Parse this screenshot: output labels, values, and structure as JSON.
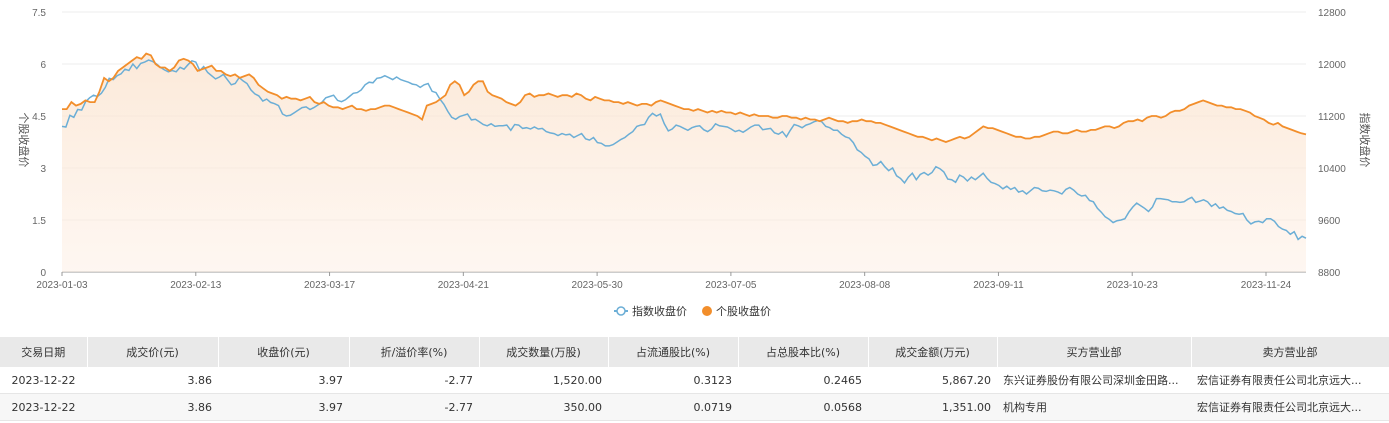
{
  "chart_data": {
    "type": "line",
    "y_left": {
      "label": "个股收盘价",
      "ticks": [
        "7.5",
        "6",
        "4.5",
        "3",
        "1.5",
        "0"
      ],
      "range": [
        0,
        7.5
      ]
    },
    "y_right": {
      "label": "指数收盘价",
      "ticks": [
        "12800",
        "12000",
        "11200",
        "10400",
        "9600",
        "8800"
      ],
      "range": [
        8800,
        12800
      ]
    },
    "x_ticks": [
      "2023-01-03",
      "2023-02-13",
      "2023-03-17",
      "2023-04-21",
      "2023-05-30",
      "2023-07-05",
      "2023-08-08",
      "2023-09-11",
      "2023-10-23",
      "2023-11-24"
    ],
    "legend": {
      "position": "bottom-center"
    },
    "series": [
      {
        "name": "指数收盘价",
        "axis": "right",
        "color": "#6baed6",
        "values": [
          11040,
          11030,
          11210,
          11180,
          11300,
          11290,
          11420,
          11480,
          11520,
          11500,
          11550,
          11640,
          11780,
          11760,
          11820,
          11850,
          11920,
          11900,
          12000,
          11930,
          12010,
          12030,
          12060,
          12040,
          12000,
          11950,
          11910,
          11880,
          11900,
          11880,
          11950,
          11920,
          11990,
          12050,
          12030,
          11900,
          11960,
          11870,
          11820,
          11770,
          11800,
          11840,
          11760,
          11680,
          11700,
          11790,
          11740,
          11700,
          11600,
          11540,
          11510,
          11430,
          11460,
          11410,
          11390,
          11360,
          11230,
          11200,
          11210,
          11250,
          11290,
          11330,
          11340,
          11300,
          11330,
          11370,
          11410,
          11480,
          11500,
          11520,
          11440,
          11420,
          11450,
          11500,
          11550,
          11560,
          11600,
          11680,
          11720,
          11710,
          11780,
          11790,
          11820,
          11790,
          11760,
          11800,
          11760,
          11740,
          11720,
          11690,
          11680,
          11640,
          11680,
          11700,
          11580,
          11560,
          11460,
          11380,
          11270,
          11180,
          11150,
          11190,
          11210,
          11230,
          11140,
          11150,
          11110,
          11070,
          11050,
          11080,
          11040,
          11050,
          11050,
          11060,
          10980,
          11070,
          11060,
          11010,
          11020,
          11000,
          11030,
          11000,
          11010,
          10960,
          10940,
          10930,
          10900,
          10930,
          10910,
          10920,
          10870,
          10900,
          10930,
          10850,
          10830,
          10870,
          10790,
          10780,
          10740,
          10740,
          10760,
          10800,
          10840,
          10870,
          10920,
          10960,
          11040,
          11060,
          11070,
          11180,
          11240,
          11200,
          11230,
          11080,
          10970,
          11000,
          11060,
          11040,
          11010,
          10980,
          11020,
          11040,
          11050,
          10990,
          10960,
          11000,
          11080,
          11050,
          11040,
          11030,
          11000,
          10960,
          10980,
          10950,
          10990,
          11030,
          11060,
          11060,
          10990,
          11000,
          11010,
          10940,
          10920,
          10960,
          10880,
          10980,
          11070,
          11050,
          11020,
          11060,
          11080,
          11110,
          11130,
          11110,
          11040,
          11020,
          10980,
          10980,
          10920,
          10880,
          10860,
          10790,
          10680,
          10640,
          10580,
          10540,
          10440,
          10450,
          10500,
          10420,
          10360,
          10400,
          10280,
          10240,
          10170,
          10260,
          10320,
          10220,
          10300,
          10330,
          10290,
          10330,
          10420,
          10390,
          10340,
          10230,
          10220,
          10180,
          10290,
          10260,
          10200,
          10260,
          10220,
          10270,
          10320,
          10240,
          10180,
          10160,
          10130,
          10080,
          10120,
          10070,
          10100,
          10030,
          10050,
          10000,
          10050,
          10100,
          10090,
          10050,
          10040,
          10060,
          10050,
          10030,
          10000,
          10070,
          10100,
          10060,
          10000,
          9970,
          9980,
          9900,
          9880,
          9780,
          9720,
          9650,
          9610,
          9560,
          9590,
          9600,
          9620,
          9720,
          9800,
          9860,
          9820,
          9780,
          9730,
          9800,
          9930,
          9930,
          9920,
          9910,
          9880,
          9880,
          9870,
          9880,
          9920,
          9950,
          9870,
          9890,
          9910,
          9880,
          9810,
          9850,
          9780,
          9800,
          9750,
          9730,
          9700,
          9690,
          9700,
          9600,
          9540,
          9570,
          9580,
          9560,
          9620,
          9620,
          9580,
          9500,
          9460,
          9440,
          9380,
          9420,
          9300,
          9350,
          9320
        ]
      },
      {
        "name": "个股收盘价",
        "axis": "left",
        "color": "#f28e2b",
        "values": [
          4.7,
          4.7,
          4.9,
          4.8,
          4.85,
          4.95,
          4.9,
          4.9,
          5.2,
          5.6,
          5.5,
          5.6,
          5.8,
          5.9,
          6.0,
          6.1,
          6.2,
          6.15,
          6.3,
          6.25,
          6.0,
          5.9,
          5.9,
          5.8,
          5.9,
          6.1,
          6.15,
          6.1,
          6.0,
          5.8,
          5.85,
          5.9,
          5.95,
          5.8,
          5.8,
          5.7,
          5.65,
          5.7,
          5.6,
          5.65,
          5.7,
          5.6,
          5.4,
          5.3,
          5.2,
          5.15,
          5.1,
          5.0,
          5.05,
          5.0,
          5.0,
          4.95,
          5.0,
          5.05,
          4.9,
          4.85,
          4.9,
          4.8,
          4.75,
          4.75,
          4.7,
          4.75,
          4.8,
          4.7,
          4.7,
          4.65,
          4.7,
          4.7,
          4.75,
          4.8,
          4.8,
          4.75,
          4.7,
          4.65,
          4.6,
          4.55,
          4.5,
          4.4,
          4.8,
          4.85,
          4.9,
          5.0,
          5.1,
          5.4,
          5.5,
          5.4,
          5.1,
          5.2,
          5.4,
          5.5,
          5.5,
          5.2,
          5.1,
          5.05,
          5.0,
          4.9,
          4.85,
          4.8,
          4.9,
          5.1,
          5.15,
          5.05,
          5.1,
          5.1,
          5.15,
          5.1,
          5.05,
          5.1,
          5.1,
          5.05,
          5.15,
          5.1,
          5.0,
          4.95,
          5.05,
          5.0,
          4.95,
          4.95,
          4.9,
          4.9,
          4.85,
          4.9,
          4.85,
          4.8,
          4.85,
          4.85,
          4.8,
          4.9,
          4.95,
          4.9,
          4.85,
          4.8,
          4.75,
          4.7,
          4.7,
          4.65,
          4.7,
          4.65,
          4.6,
          4.65,
          4.6,
          4.65,
          4.6,
          4.6,
          4.55,
          4.6,
          4.55,
          4.5,
          4.55,
          4.5,
          4.5,
          4.5,
          4.45,
          4.45,
          4.5,
          4.5,
          4.45,
          4.45,
          4.4,
          4.45,
          4.4,
          4.4,
          4.35,
          4.4,
          4.45,
          4.4,
          4.35,
          4.35,
          4.3,
          4.35,
          4.35,
          4.4,
          4.35,
          4.35,
          4.3,
          4.3,
          4.25,
          4.2,
          4.15,
          4.1,
          4.05,
          4.0,
          3.95,
          3.9,
          3.9,
          3.85,
          3.8,
          3.85,
          3.8,
          3.75,
          3.8,
          3.85,
          3.9,
          3.85,
          3.9,
          4.0,
          4.1,
          4.2,
          4.15,
          4.15,
          4.1,
          4.05,
          4.0,
          3.95,
          3.9,
          3.9,
          3.85,
          3.85,
          3.9,
          3.9,
          3.95,
          4.0,
          4.05,
          4.05,
          4.0,
          4.0,
          4.05,
          4.1,
          4.05,
          4.05,
          4.1,
          4.1,
          4.15,
          4.2,
          4.2,
          4.15,
          4.2,
          4.3,
          4.35,
          4.35,
          4.4,
          4.35,
          4.45,
          4.5,
          4.5,
          4.45,
          4.5,
          4.6,
          4.65,
          4.65,
          4.7,
          4.8,
          4.85,
          4.9,
          4.95,
          4.9,
          4.85,
          4.8,
          4.8,
          4.75,
          4.75,
          4.7,
          4.7,
          4.65,
          4.6,
          4.5,
          4.45,
          4.4,
          4.3,
          4.25,
          4.3,
          4.2,
          4.15,
          4.1,
          4.05,
          4.0,
          3.97
        ]
      }
    ]
  },
  "table": {
    "headers": [
      "交易日期",
      "成交价(元)",
      "收盘价(元)",
      "折/溢价率(%)",
      "成交数量(万股)",
      "占流通股比(%)",
      "占总股本比(%)",
      "成交金额(万元)",
      "买方营业部",
      "卖方营业部"
    ],
    "rows": [
      [
        "2023-12-22",
        "3.86",
        "3.97",
        "-2.77",
        "1,520.00",
        "0.3123",
        "0.2465",
        "5,867.20",
        "东兴证券股份有限公司深圳金田路...",
        "宏信证券有限责任公司北京远大..."
      ],
      [
        "2023-12-22",
        "3.86",
        "3.97",
        "-2.77",
        "350.00",
        "0.0719",
        "0.0568",
        "1,351.00",
        "机构专用",
        "宏信证券有限责任公司北京远大..."
      ]
    ]
  }
}
